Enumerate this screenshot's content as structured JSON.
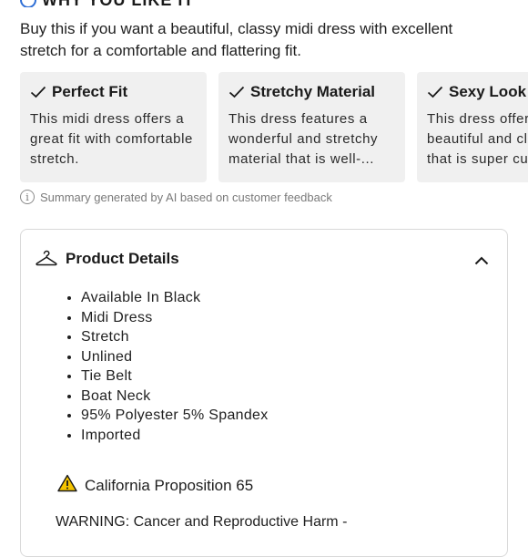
{
  "section_title": "WHY YOU LIKE IT",
  "summary": "Buy this if you want a beautiful, classy midi dress with excellent stretch for a comfortable and flattering fit.",
  "cards": [
    {
      "title": "Perfect Fit",
      "text": "This midi dress offers a great fit with comfortable stretch."
    },
    {
      "title": "Stretchy Material",
      "text": "This dress features a wonderful and stretchy material that is well-..."
    },
    {
      "title": "Sexy Look",
      "text": "This dress offers a beautiful and classy look that is super cute"
    }
  ],
  "ai_note": "Summary generated by AI based on customer feedback",
  "product_details": {
    "title": "Product Details",
    "items": [
      "Available In Black",
      "Midi Dress",
      "Stretch",
      "Unlined",
      "Tie Belt",
      "Boat Neck",
      "95% Polyester 5% Spandex",
      "Imported"
    ],
    "prop65_label": "California Proposition 65",
    "warning_text": "WARNING: Cancer and Reproductive Harm -"
  },
  "colors": {
    "accent": "#2f6fd6",
    "card_bg": "#f0f0f0",
    "muted": "#7a7a7a",
    "warning_yellow": "#f5c400"
  },
  "icons": {
    "card_check": "check-icon",
    "info": "info-icon",
    "details": "hanger-icon",
    "toggle": "chevron-up-icon",
    "prop65": "warning-triangle-icon"
  }
}
